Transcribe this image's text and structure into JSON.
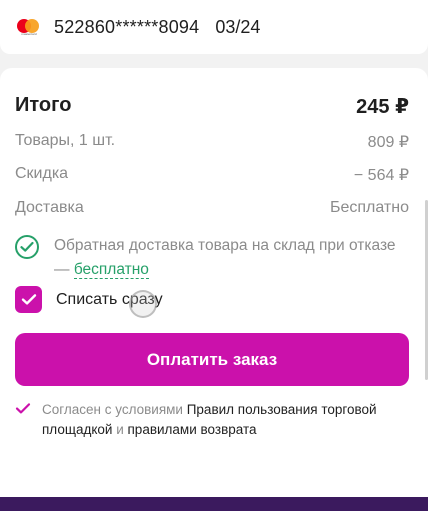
{
  "card": {
    "brand_icon": "mastercard-icon",
    "brand_caption": "mastercard",
    "number": "522860******8094",
    "expiry": "03/24"
  },
  "summary": {
    "total_label": "Итого",
    "total_value": "245 ₽",
    "goods_label": "Товары, 1 шт.",
    "goods_value": "809 ₽",
    "discount_label": "Скидка",
    "discount_value": "− 564 ₽",
    "delivery_label": "Доставка",
    "delivery_value": "Бесплатно"
  },
  "return_delivery": {
    "icon": "check-circle-icon",
    "text_prefix": "Обратная доставка товара на склад при отказе — ",
    "free_link": "бесплатно"
  },
  "write_off": {
    "label": "Списать сразу",
    "checked": true
  },
  "pay_button": {
    "label": "Оплатить заказ"
  },
  "terms": {
    "agree": "Согласен с условиями ",
    "rules_link": "Правил пользования торговой площадкой",
    "and": " и ",
    "return_link": "правилами возврата"
  },
  "colors": {
    "accent": "#cb11ab",
    "success": "#26a069",
    "muted_text": "#8b8b8b",
    "bottom_bar": "#3b1a5e"
  }
}
